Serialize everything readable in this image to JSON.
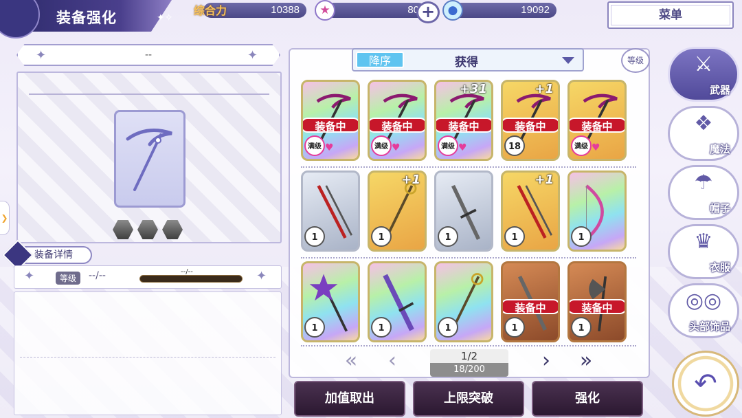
{
  "header": {
    "title": "装备强化",
    "power_label": "综合力",
    "power_value": "10388",
    "stamina_value": "80",
    "currency_value": "19092",
    "menu_label": "菜单",
    "plus_symbol": "+"
  },
  "preview": {
    "item_name": "--",
    "detail_tab_label": "装备详情",
    "level_label": "等级",
    "level_value": "--/--",
    "exp_text": "--/--"
  },
  "sort": {
    "order_label": "降序",
    "key_label": "获得",
    "level_filter_label": "等级"
  },
  "inventory": {
    "items": [
      {
        "rarity": "rainbow",
        "equipped": true,
        "equipped_label": "装备中",
        "plus": "",
        "level": "满级",
        "max": true,
        "icon": "scythe-icon"
      },
      {
        "rarity": "rainbow",
        "equipped": true,
        "equipped_label": "装备中",
        "plus": "",
        "level": "满级",
        "max": true,
        "icon": "scythe-icon"
      },
      {
        "rarity": "rainbow",
        "equipped": true,
        "equipped_label": "装备中",
        "plus": "+31",
        "level": "满级",
        "max": true,
        "icon": "scythe-icon"
      },
      {
        "rarity": "gold",
        "equipped": true,
        "equipped_label": "装备中",
        "plus": "+1",
        "level": "18",
        "max": false,
        "icon": "scythe-icon"
      },
      {
        "rarity": "gold",
        "equipped": true,
        "equipped_label": "装备中",
        "plus": "",
        "level": "满级",
        "max": true,
        "icon": "scythe-icon"
      },
      {
        "rarity": "silver",
        "equipped": false,
        "equipped_label": "",
        "plus": "",
        "level": "1",
        "max": false,
        "icon": "dual-blade-icon"
      },
      {
        "rarity": "gold",
        "equipped": false,
        "equipped_label": "",
        "plus": "+1",
        "level": "1",
        "max": false,
        "icon": "staff-icon"
      },
      {
        "rarity": "silver",
        "equipped": false,
        "equipped_label": "",
        "plus": "",
        "level": "1",
        "max": false,
        "icon": "sword-icon"
      },
      {
        "rarity": "gold",
        "equipped": false,
        "equipped_label": "",
        "plus": "+1",
        "level": "1",
        "max": false,
        "icon": "dual-blade-icon"
      },
      {
        "rarity": "rainbow",
        "equipped": false,
        "equipped_label": "",
        "plus": "",
        "level": "1",
        "max": false,
        "icon": "bow-icon"
      },
      {
        "rarity": "rainbow",
        "equipped": false,
        "equipped_label": "",
        "plus": "",
        "level": "1",
        "max": false,
        "icon": "star-staff-icon"
      },
      {
        "rarity": "rainbow",
        "equipped": false,
        "equipped_label": "",
        "plus": "",
        "level": "1",
        "max": false,
        "icon": "greatsword-icon"
      },
      {
        "rarity": "rainbow",
        "equipped": false,
        "equipped_label": "",
        "plus": "",
        "level": "1",
        "max": false,
        "icon": "staff-icon"
      },
      {
        "rarity": "bronze",
        "equipped": true,
        "equipped_label": "装备中",
        "plus": "",
        "level": "1",
        "max": false,
        "icon": "sword-icon"
      },
      {
        "rarity": "bronze",
        "equipped": true,
        "equipped_label": "装备中",
        "plus": "",
        "level": "1",
        "max": false,
        "icon": "axe-icon"
      }
    ]
  },
  "pager": {
    "page": "1/2",
    "count": "18/200"
  },
  "actions": {
    "cancel_bonus": "加值取出",
    "limit_break": "上限突破",
    "enhance": "强化"
  },
  "categories": [
    {
      "label": "武器",
      "icon": "weapon-icon",
      "active": true
    },
    {
      "label": "魔法",
      "icon": "magic-card-icon",
      "active": false
    },
    {
      "label": "帽子",
      "icon": "hat-icon",
      "active": false
    },
    {
      "label": "衣服",
      "icon": "clothes-icon",
      "active": false
    },
    {
      "label": "头部饰品",
      "icon": "glasses-icon",
      "active": false
    }
  ],
  "colors": {
    "equipped_red": "#c7172a",
    "accent_purple": "#514a9a",
    "sort_blue": "#5fc4f0"
  }
}
